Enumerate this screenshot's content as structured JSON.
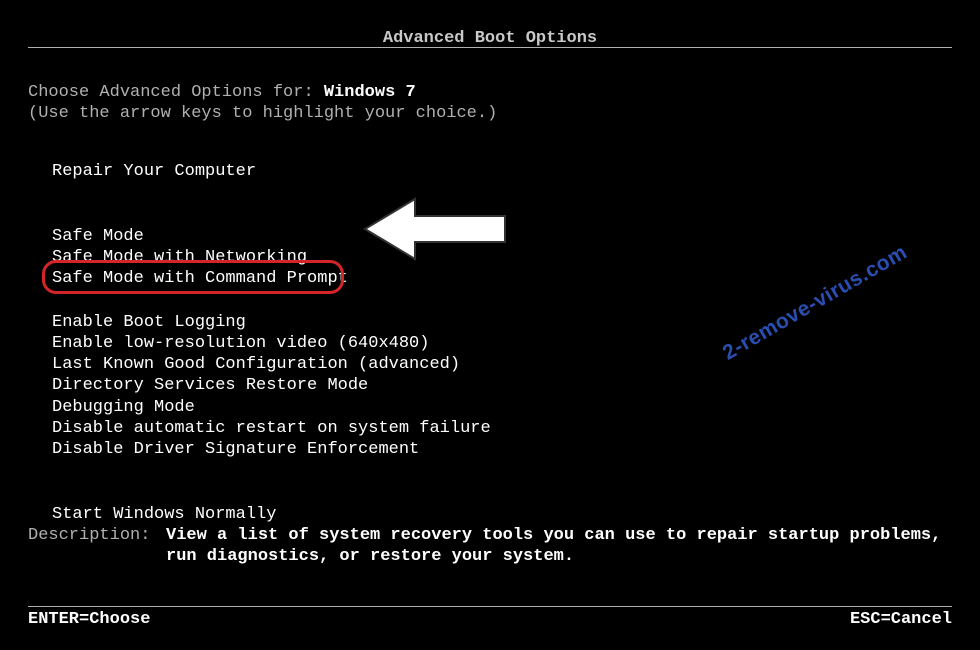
{
  "title": "Advanced Boot Options",
  "prompt": {
    "line1_prefix": "Choose Advanced Options for: ",
    "os_name": "Windows 7",
    "line2": "(Use the arrow keys to highlight your choice.)"
  },
  "menu": {
    "group1": [
      "Repair Your Computer"
    ],
    "group2": [
      "Safe Mode",
      "Safe Mode with Networking",
      "Safe Mode with Command Prompt"
    ],
    "group3": [
      "Enable Boot Logging",
      "Enable low-resolution video (640x480)",
      "Last Known Good Configuration (advanced)",
      "Directory Services Restore Mode",
      "Debugging Mode",
      "Disable automatic restart on system failure",
      "Disable Driver Signature Enforcement"
    ],
    "group4": [
      "Start Windows Normally"
    ],
    "highlighted_index": "group2.2"
  },
  "description": {
    "label": "Description:",
    "text": "View a list of system recovery tools you can use to repair startup problems, run diagnostics, or restore your system."
  },
  "footer": {
    "left": "ENTER=Choose",
    "right": "ESC=Cancel"
  },
  "watermark": "2-remove-virus.com",
  "colors": {
    "highlight_border": "#d4262a",
    "text_dim": "#b0b0b0",
    "text_bright": "#ffffff",
    "watermark": "#2a4db0"
  }
}
